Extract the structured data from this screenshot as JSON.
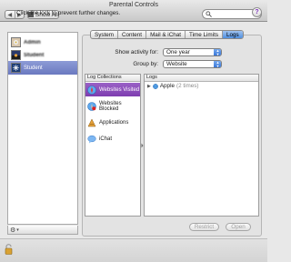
{
  "window": {
    "title": "Parental Controls"
  },
  "toolbar": {
    "back_glyph": "◀",
    "forward_glyph": "▶",
    "show_all_label": "Show All",
    "search_value": "",
    "search_icon": "search-icon"
  },
  "users": {
    "items": [
      {
        "label": "Admin",
        "redacted": true,
        "avatar": "flower-avatar"
      },
      {
        "label": "Student",
        "redacted": true,
        "avatar": "sunset-avatar"
      },
      {
        "label": "Student",
        "redacted": false,
        "selected": true,
        "avatar": "snowflake-avatar"
      }
    ],
    "gear_glyph": "⚙",
    "gear_menu_glyph": "▾"
  },
  "tabs": [
    {
      "label": "System"
    },
    {
      "label": "Content"
    },
    {
      "label": "Mail & iChat"
    },
    {
      "label": "Time Limits"
    },
    {
      "label": "Logs",
      "active": true
    }
  ],
  "filters": {
    "show_activity_label": "Show activity for:",
    "show_activity_value": "One year",
    "group_by_label": "Group by:",
    "group_by_value": "Website"
  },
  "collections": {
    "header": "Log Collections",
    "items": [
      {
        "label": "Websites Visited",
        "icon": "safari-compass-icon",
        "selected": true
      },
      {
        "label": "Websites Blocked",
        "icon": "blocked-compass-icon"
      },
      {
        "label": "Applications",
        "icon": "applications-icon"
      },
      {
        "label": "iChat",
        "icon": "ichat-icon"
      }
    ]
  },
  "logs": {
    "header": "Logs",
    "rows": [
      {
        "disclosure": "▶",
        "label": "Apple",
        "count": "(2 times)",
        "icon": "globe-icon"
      }
    ]
  },
  "actions": {
    "restrict_label": "Restrict",
    "open_label": "Open"
  },
  "footer": {
    "lock_message": "Click the lock to prevent further changes.",
    "help_glyph": "?"
  },
  "colors": {
    "selection_blue": "#6a79c0",
    "collection_purple": "#7e3db0",
    "tab_active": "#4f8fe0"
  }
}
